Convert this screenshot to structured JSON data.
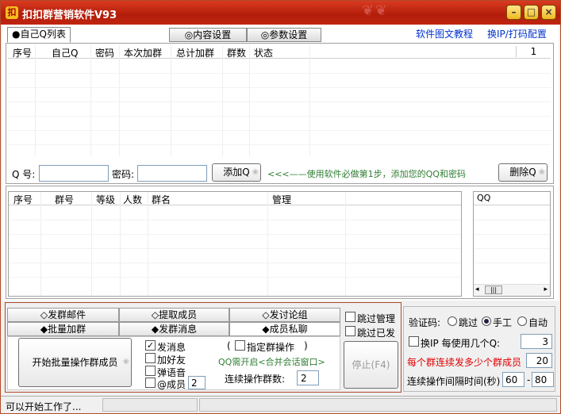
{
  "window": {
    "title": "扣扣群营销软件V93"
  },
  "tabs": [
    {
      "label": "●自己Q列表"
    },
    {
      "label": "◎内容设置"
    },
    {
      "label": "◎参数设置"
    }
  ],
  "links": {
    "tutorial": "软件图文教程",
    "ip_config": "换IP/打码配置"
  },
  "qq_list": {
    "columns": [
      "序号",
      "自己Q",
      "密码",
      "本次加群",
      "总计加群",
      "群数",
      "状态"
    ],
    "page": "1",
    "rows": []
  },
  "add_form": {
    "qq_label": "Q 号:",
    "qq_value": "",
    "pwd_label": "密码:",
    "pwd_value": "",
    "add_button": "添加Q",
    "hint": "<<<——使用软件必做第1步，添加您的QQ和密码",
    "delete_button": "删除Q"
  },
  "group_list": {
    "columns": [
      "序号",
      "群号",
      "等级",
      "人数",
      "群名",
      "管理"
    ],
    "rows": []
  },
  "qq_side": {
    "column": "QQ",
    "scroll_thumb": "|||"
  },
  "bottom_tabs": [
    {
      "label": "◇发群邮件"
    },
    {
      "label": "◇提取成员"
    },
    {
      "label": "◇发讨论组"
    },
    {
      "label": "◆批量加群"
    },
    {
      "label": "◆发群消息"
    },
    {
      "label": "◆成员私聊"
    }
  ],
  "action": {
    "start_button": "开始批量操作群成员",
    "send_msg": {
      "label": "发消息",
      "checked": true
    },
    "add_friend": {
      "label": "加好友",
      "checked": false
    },
    "popup": {
      "label": "弹语音",
      "checked": false
    },
    "at_member": {
      "label": "@成员",
      "checked": false,
      "value": "2"
    },
    "specific_group": "指定群操作",
    "paren_open": "(",
    "paren_close": ")",
    "qq_hint": "QQ需开启<合并会话窗口>",
    "continuous_label": "连续操作群数:",
    "continuous_value": "2",
    "stop_button": "停止(F4)"
  },
  "skip": {
    "skip_admin": "跳过管理",
    "skip_sent": "跳过已发"
  },
  "settings": {
    "captcha_label": "验证码:",
    "captcha_options": [
      {
        "label": "跳过",
        "selected": false
      },
      {
        "label": "手工",
        "selected": true
      },
      {
        "label": "自动",
        "selected": false
      }
    ],
    "change_ip_label": "换IP 每使用几个Q:",
    "change_ip_value": "3",
    "per_group_label": "每个群连续发多少个群成员",
    "per_group_value": "20",
    "interval_label": "连续操作间隔时间(秒)",
    "interval_min": "60",
    "interval_dash": "-",
    "interval_max": "80"
  },
  "status": {
    "text": "可以开始工作了..."
  },
  "colors": {
    "titlebar": "#c02510",
    "link": "#0033cc",
    "hint": "#2e7d32",
    "warn": "#e00000"
  }
}
